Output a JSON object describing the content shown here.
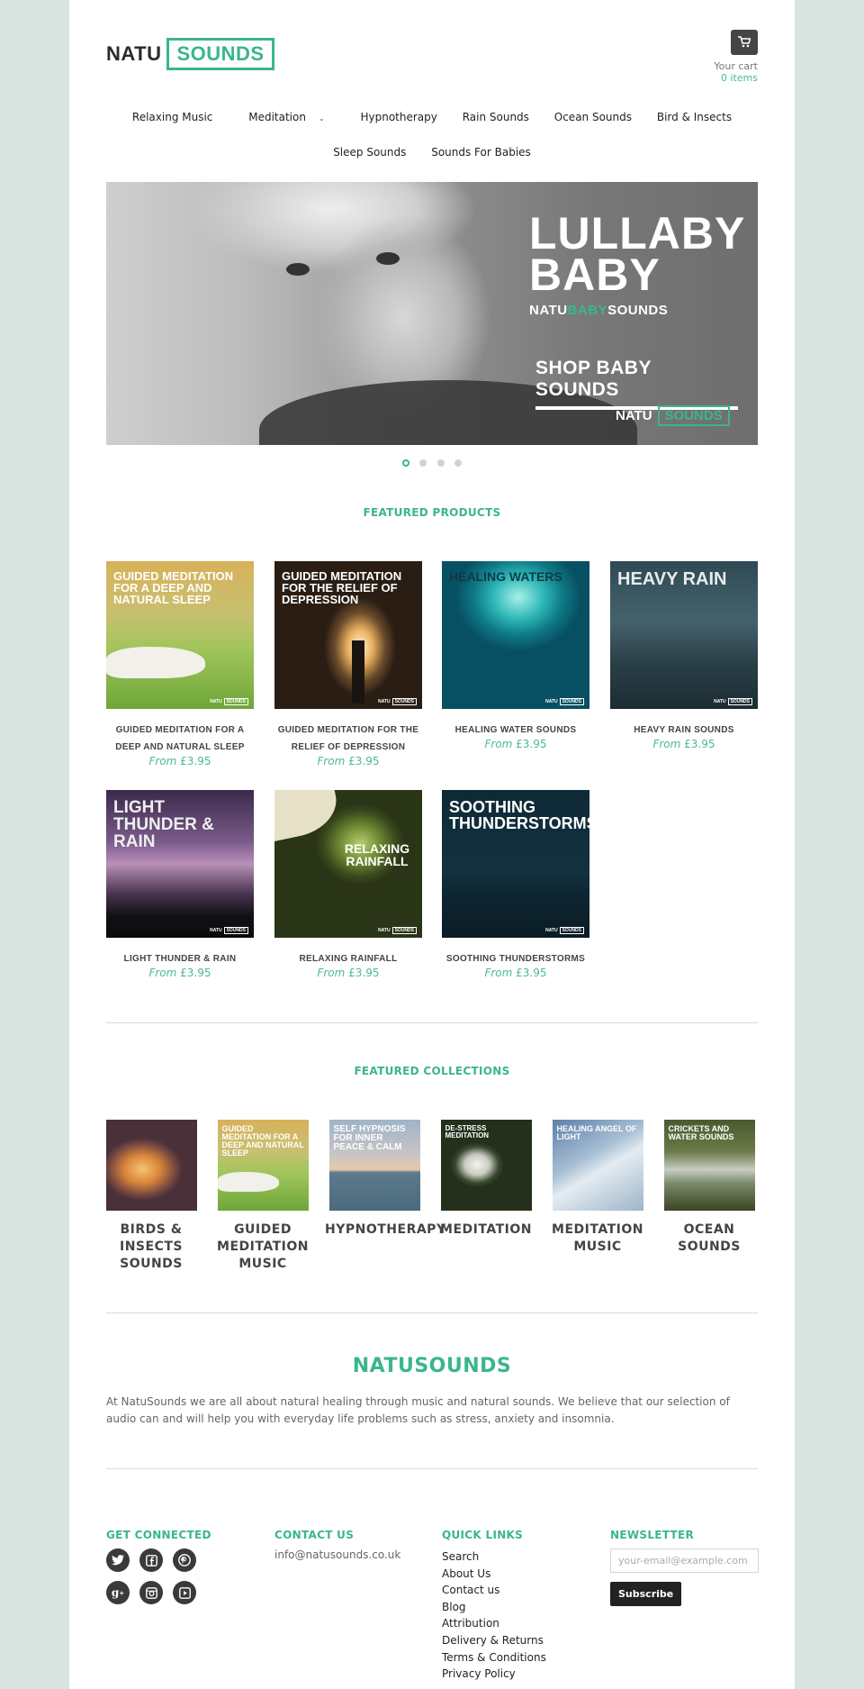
{
  "header": {
    "logo_left": "NATU",
    "logo_right": "SOUNDS",
    "cart_label": "Your cart",
    "cart_count": "0 items"
  },
  "nav": {
    "row1": [
      "Relaxing Music",
      "Meditation",
      "Hypnotherapy",
      "Rain Sounds",
      "Ocean Sounds",
      "Bird & Insects"
    ],
    "row2": [
      "Sleep Sounds",
      "Sounds For Babies"
    ],
    "dropdown_indicator": "⌄"
  },
  "hero": {
    "title_line1": "LULLABY",
    "title_line2": "BABY",
    "brand_a": "NATU",
    "brand_b": "BABY",
    "brand_c": "SOUNDS",
    "cta": "SHOP BABY SOUNDS",
    "logo_left": "NATU",
    "logo_right": "SOUNDS",
    "slides": 4,
    "active_slide": 1
  },
  "featured_products": {
    "title": "FEATURED PRODUCTS",
    "price_prefix": "From",
    "items": [
      {
        "name": "GUIDED MEDITATION FOR A DEEP AND NATURAL SLEEP",
        "price": "£3.95",
        "cover_title": "GUIDED MEDITATION FOR A DEEP AND NATURAL SLEEP"
      },
      {
        "name": "GUIDED MEDITATION FOR THE RELIEF OF DEPRESSION",
        "price": "£3.95",
        "cover_title": "GUIDED MEDITATION FOR THE RELIEF OF DEPRESSION"
      },
      {
        "name": "HEALING WATER SOUNDS",
        "price": "£3.95",
        "cover_title": "HEALING WATERS"
      },
      {
        "name": "HEAVY RAIN SOUNDS",
        "price": "£3.95",
        "cover_title": "HEAVY RAIN"
      },
      {
        "name": "LIGHT THUNDER & RAIN",
        "price": "£3.95",
        "cover_title": "LIGHT THUNDER & RAIN"
      },
      {
        "name": "RELAXING RAINFALL",
        "price": "£3.95",
        "cover_title": "RELAXING RAINFALL"
      },
      {
        "name": "SOOTHING THUNDERSTORMS",
        "price": "£3.95",
        "cover_title": "SOOTHING THUNDERSTORMS"
      }
    ],
    "cover_sub": "NATUSOUNDS",
    "cover_tag_a": "NATU",
    "cover_tag_b": "SOUNDS"
  },
  "featured_collections": {
    "title": "FEATURED COLLECTIONS",
    "items": [
      {
        "name": "BIRDS & INSECTS SOUNDS",
        "cover_title": ""
      },
      {
        "name": "GUIDED MEDITATION MUSIC",
        "cover_title": "GUIDED MEDITATION FOR A DEEP AND NATURAL SLEEP"
      },
      {
        "name": "HYPNOTHERAPY",
        "cover_title": "SELF HYPNOSIS FOR INNER PEACE & CALM"
      },
      {
        "name": "MEDITATION",
        "cover_title": "DE-STRESS MEDITATION"
      },
      {
        "name": "MEDITATION MUSIC",
        "cover_title": "HEALING ANGEL OF LIGHT"
      },
      {
        "name": "OCEAN SOUNDS",
        "cover_title": "CRICKETS AND WATER SOUNDS"
      }
    ]
  },
  "about": {
    "title": "NATUSOUNDS",
    "text": "At NatuSounds we are all about natural healing through music and natural sounds. We believe that our selection of audio can and will help you with everyday life problems such as stress, anxiety and insomnia."
  },
  "footer": {
    "get_connected": "GET CONNECTED",
    "social": [
      "twitter",
      "facebook",
      "pinterest",
      "google-plus",
      "instagram",
      "youtube"
    ],
    "contact_title": "CONTACT US",
    "contact_email": "info@natusounds.co.uk",
    "quick_links_title": "QUICK LINKS",
    "quick_links": [
      "Search",
      "About Us",
      "Contact us",
      "Blog",
      "Attribution",
      "Delivery & Returns",
      "Terms & Conditions",
      "Privacy Policy"
    ],
    "newsletter_title": "NEWSLETTER",
    "newsletter_placeholder": "your-email@example.com",
    "subscribe_label": "Subscribe"
  },
  "colors": {
    "accent": "#3ab68a",
    "page_bg": "#d9e4e0",
    "dark_button": "#222222"
  }
}
